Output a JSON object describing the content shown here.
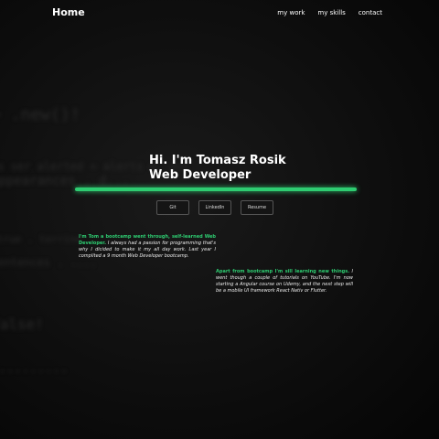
{
  "nav": {
    "brand": "Home",
    "links": [
      "my work",
      "my skills",
      "contact"
    ]
  },
  "hero": {
    "line1": "Hi. I'm Tomasz Rosik",
    "line2": "Web Developer"
  },
  "buttons": [
    "Git",
    "LinkedIn",
    "Resume"
  ],
  "about": {
    "p1_highlight": "I'm Tom a bootcamp went through, self-learned Web Developer.",
    "p1_text": " I always had a passion for programming that's why I dicided to make it my all day work. Last year I complited a 9 month Web Developer bootcamp.",
    "p2_highlight": "Apart from bootcamp I'm sill learning new things.",
    "p2_text": " I went though a couple of tutorials on YouTube. I'm now starting a Angular course on Udemy, and the next step will be a mobile UI framework React Nativ or Flutter."
  },
  "colors": {
    "accent": "#2ecc71",
    "background": "#0c0c0c"
  }
}
